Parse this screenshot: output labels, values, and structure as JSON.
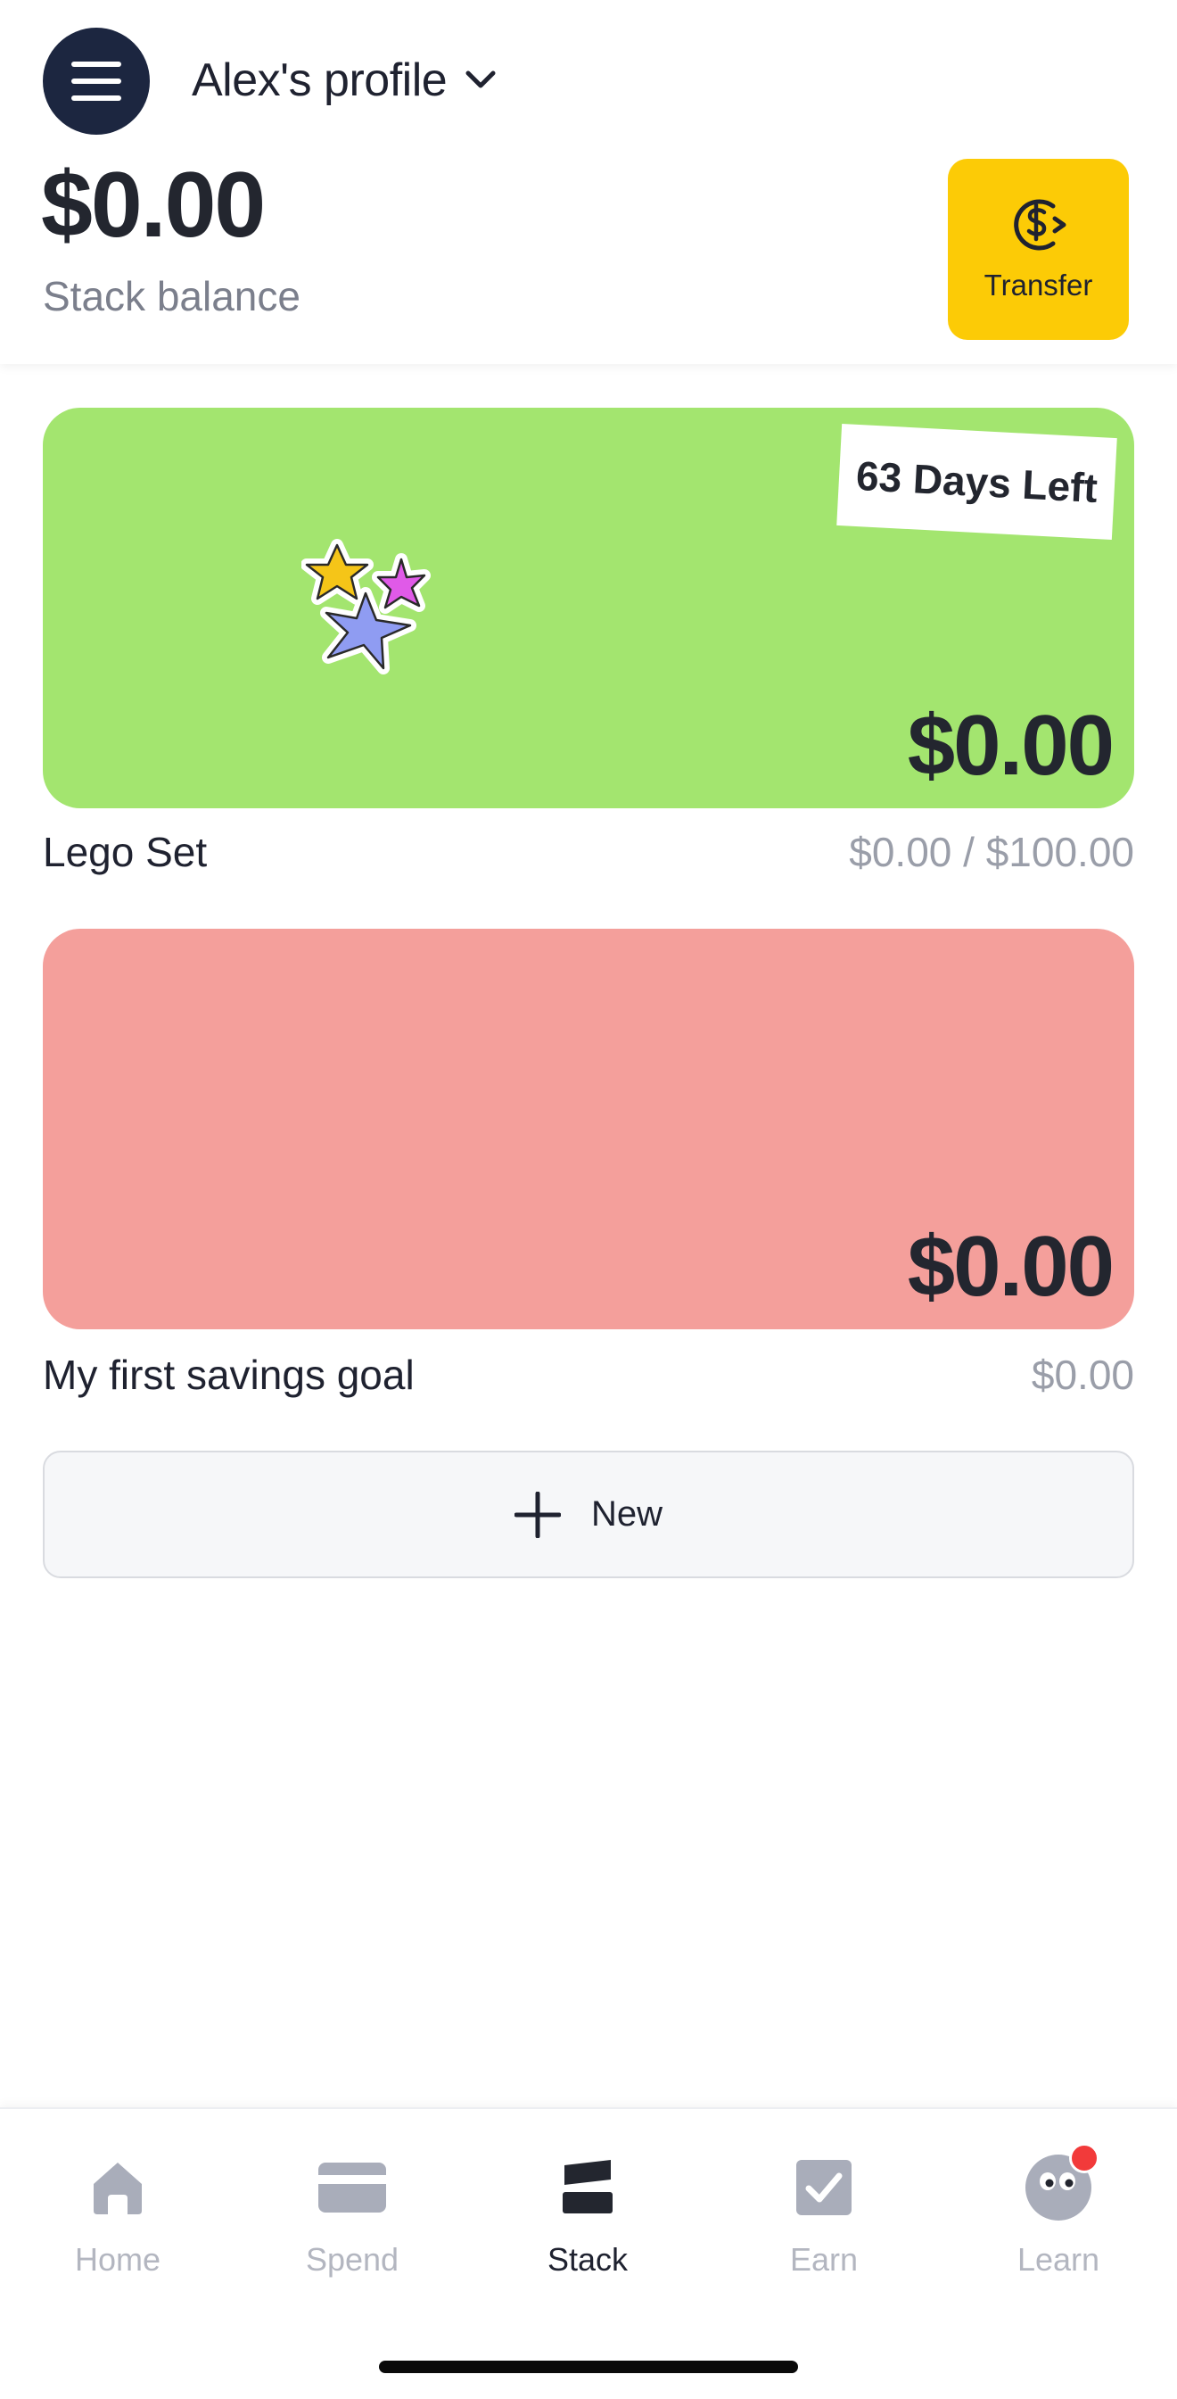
{
  "header": {
    "profile_name": "Alex's profile",
    "balance": "$0.00",
    "balance_label": "Stack balance",
    "transfer_label": "Transfer"
  },
  "goals": [
    {
      "name": "Lego Set",
      "amount": "$0.00",
      "progress": "$0.00 / $100.00",
      "days_left": "63 Days Left",
      "color": "#a3e56f",
      "sticker": "stars-sticker"
    },
    {
      "name": "My first savings goal",
      "amount": "$0.00",
      "progress": "$0.00",
      "color": "#f49f9b"
    }
  ],
  "new_button_label": "New",
  "nav": {
    "items": [
      {
        "label": "Home",
        "icon": "home-icon",
        "active": false
      },
      {
        "label": "Spend",
        "icon": "card-icon",
        "active": false
      },
      {
        "label": "Stack",
        "icon": "stack-icon",
        "active": true
      },
      {
        "label": "Earn",
        "icon": "checkbox-icon",
        "active": false
      },
      {
        "label": "Learn",
        "icon": "eyes-icon",
        "active": false,
        "notification": true
      }
    ]
  },
  "colors": {
    "accent_yellow": "#fccb06",
    "menu_navy": "#1c2640",
    "notification_red": "#f23a3a"
  }
}
